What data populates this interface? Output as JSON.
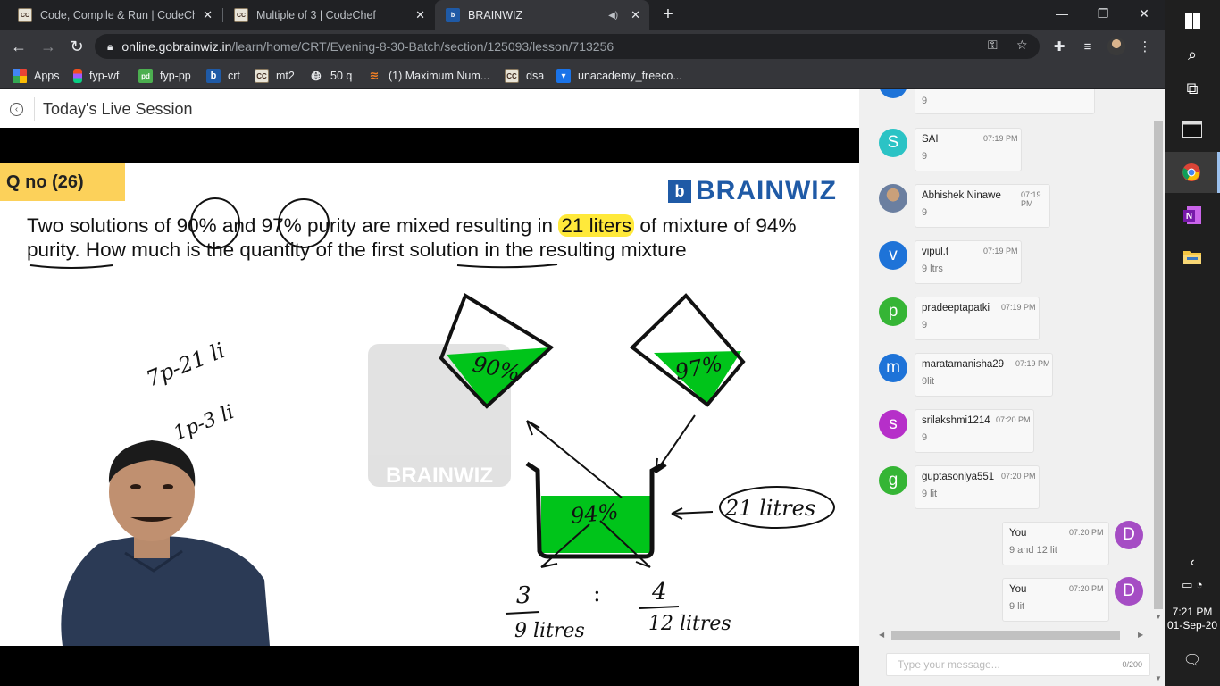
{
  "browser": {
    "tabs": [
      {
        "title": "Code, Compile & Run | CodeChef",
        "favicon": "codechef-icon",
        "active": false
      },
      {
        "title": "Multiple of 3 | CodeChef",
        "favicon": "codechef-icon",
        "active": false
      },
      {
        "title": "BRAINWIZ",
        "favicon": "brainwiz-icon",
        "active": true
      }
    ],
    "url_host": "online.gobrainwiz.in",
    "url_path": "/learn/home/CRT/Evening-8-30-Batch/section/125093/lesson/713256",
    "bookmarks": [
      {
        "label": "Apps",
        "icon": "apps-grid-icon"
      },
      {
        "label": "fyp-wf",
        "icon": "figma-icon"
      },
      {
        "label": "fyp-pp",
        "icon": "pd-icon"
      },
      {
        "label": "crt",
        "icon": "brainwiz-icon"
      },
      {
        "label": "mt2",
        "icon": "codechef-icon"
      },
      {
        "label": "50 q",
        "icon": "globe-icon"
      },
      {
        "label": "(1) Maximum Num...",
        "icon": "stackoverflow-icon"
      },
      {
        "label": "dsa",
        "icon": "codechef-icon"
      },
      {
        "label": "unacademy_freeco...",
        "icon": "inbox-icon"
      }
    ]
  },
  "page": {
    "session_title": "Today's Live Session",
    "slide": {
      "question_no": "Q no (26)",
      "logo_mark": "b",
      "logo_text": "BRAINWIZ",
      "watermark_text": "BRAINWIZ",
      "question_part1": "Two solutions of 90% and 97% purity are mixed resulting in ",
      "question_highlight": "21 liters",
      "question_part2": " of mixture of 94% purity. How much is the quantity of the first solution in the resulting mixture",
      "handwriting": {
        "note1": "7p-21 li",
        "note2": "1p-3 li",
        "beaker1": "90%",
        "beaker2": "97%",
        "beaker3": "94%",
        "total": "21 litres",
        "ratio_left_top": "3",
        "ratio_left_bottom": "9 litres",
        "ratio_sep": ":",
        "ratio_right_top": "4",
        "ratio_right_bottom": "12 litres"
      }
    }
  },
  "chat": {
    "messages": [
      {
        "initial": "",
        "color": "#1e73d8",
        "name": "",
        "time": "",
        "text": "9",
        "self": false,
        "photo": false
      },
      {
        "initial": "S",
        "color": "#2bc3c5",
        "name": "SAI",
        "time": "07:19 PM",
        "text": "9",
        "self": false,
        "photo": false
      },
      {
        "initial": "",
        "color": "#9aa7b5",
        "name": "Abhishek Ninawe",
        "time": "07:19 PM",
        "text": "9",
        "self": false,
        "photo": true
      },
      {
        "initial": "v",
        "color": "#1e73d8",
        "name": "vipul.t",
        "time": "07:19 PM",
        "text": "9 ltrs",
        "self": false,
        "photo": false
      },
      {
        "initial": "p",
        "color": "#35b535",
        "name": "pradeeptapatki",
        "time": "07:19 PM",
        "text": "9",
        "self": false,
        "photo": false
      },
      {
        "initial": "m",
        "color": "#1e73d8",
        "name": "maratamanisha29",
        "time": "07:19 PM",
        "text": "9lit",
        "self": false,
        "photo": false
      },
      {
        "initial": "s",
        "color": "#b62fc9",
        "name": "srilakshmi1214",
        "time": "07:20 PM",
        "text": "9",
        "self": false,
        "photo": false
      },
      {
        "initial": "g",
        "color": "#35b535",
        "name": "guptasoniya551",
        "time": "07:20 PM",
        "text": "9 lit",
        "self": false,
        "photo": false
      },
      {
        "initial": "D",
        "color": "#a54dc4",
        "name": "You",
        "time": "07:20 PM",
        "text": "9 and 12 lit",
        "self": true,
        "photo": false
      },
      {
        "initial": "D",
        "color": "#a54dc4",
        "name": "You",
        "time": "07:20 PM",
        "text": "9 lit",
        "self": true,
        "photo": false
      }
    ],
    "input_placeholder": "Type your message...",
    "char_count": "0/200"
  },
  "taskbar": {
    "time": "7:21 PM",
    "date": "01-Sep-20"
  }
}
